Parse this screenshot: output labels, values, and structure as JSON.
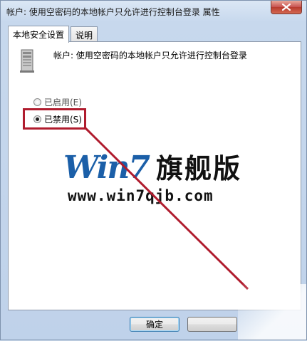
{
  "window": {
    "title": "帐户: 使用空密码的本地帐户只允许进行控制台登录 属性",
    "close_icon": "close-icon"
  },
  "tabs": [
    {
      "label": "本地安全设置",
      "active": true
    },
    {
      "label": "说明",
      "active": false
    }
  ],
  "policy": {
    "icon": "server-icon",
    "text": "帐户: 使用空密码的本地帐户只允许进行控制台登录"
  },
  "options": [
    {
      "label": "已启用(E)",
      "checked": false
    },
    {
      "label": "已禁用(S)",
      "checked": true
    }
  ],
  "annotation": {
    "color": "#b01c2e"
  },
  "watermark": {
    "logo": "Win7",
    "brand": "旗舰版",
    "url": "www.win7qjb.com"
  },
  "buttons": {
    "ok_label": "确定"
  }
}
